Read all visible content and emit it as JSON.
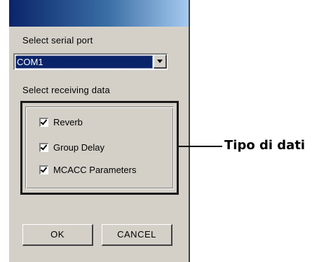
{
  "dialog": {
    "serial_port_label": "Select serial port",
    "serial_port_value": "COM1",
    "receiving_label": "Select receiving data",
    "options": [
      {
        "label": "Reverb",
        "checked": true
      },
      {
        "label": "Group Delay",
        "checked": true
      },
      {
        "label": "MCACC Parameters",
        "checked": true
      }
    ],
    "ok_label": "OK",
    "cancel_label": "CANCEL"
  },
  "callout": {
    "text": "Tipo di dati"
  },
  "colors": {
    "dialog_bg": "#d4d0c8",
    "titlebar_start": "#0a246a",
    "titlebar_end": "#a6caf0",
    "selection_bg": "#0a246a"
  }
}
